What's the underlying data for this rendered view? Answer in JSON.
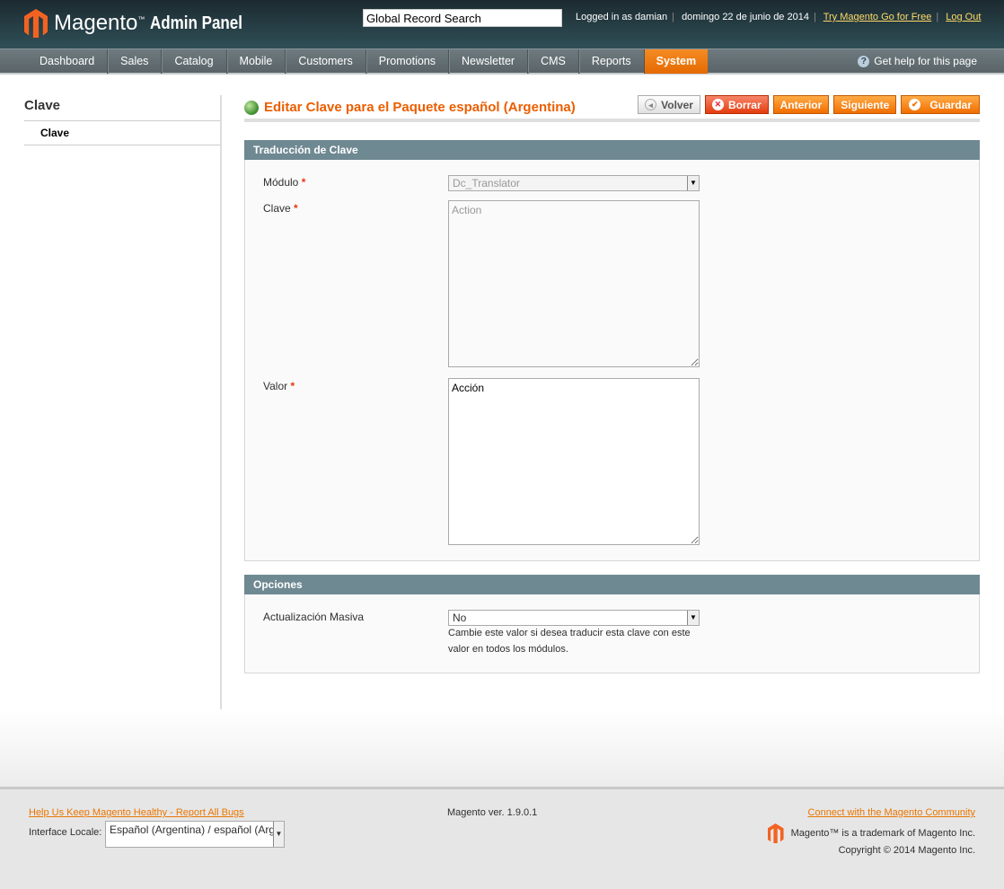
{
  "header": {
    "logo_text": "Magento",
    "logo_suffix": "Admin Panel",
    "search_placeholder": "Global Record Search",
    "logged_in": "Logged in as damian",
    "date": "domingo 22 de junio de 2014",
    "try_link": "Try Magento Go for Free",
    "logout": "Log Out"
  },
  "nav": {
    "items": [
      "Dashboard",
      "Sales",
      "Catalog",
      "Mobile",
      "Customers",
      "Promotions",
      "Newsletter",
      "CMS",
      "Reports",
      "System"
    ],
    "active": "System",
    "help": "Get help for this page"
  },
  "sidebar": {
    "title": "Clave",
    "items": [
      {
        "label": "Clave"
      }
    ]
  },
  "page": {
    "title": "Editar Clave para el Paquete español (Argentina)",
    "buttons": {
      "back": "Volver",
      "delete": "Borrar",
      "prev": "Anterior",
      "next": "Siguiente",
      "save": "Guardar"
    }
  },
  "fieldset1": {
    "title": "Traducción de Clave",
    "module_label": "Módulo",
    "module_value": "Dc_Translator",
    "key_label": "Clave",
    "key_value": "Action",
    "value_label": "Valor",
    "value_value": "Acción",
    "required": "*"
  },
  "fieldset2": {
    "title": "Opciones",
    "mass_label": "Actualización Masiva",
    "mass_value": "No",
    "note": "Cambie este valor si desea traducir esta clave con este valor en todos los módulos."
  },
  "footer": {
    "bugs_link": "Help Us Keep Magento Healthy - Report All Bugs",
    "locale_label": "Interface Locale:",
    "locale_value": "Español (Argentina) / español (Argentina)",
    "version": "Magento ver. 1.9.0.1",
    "community_link": "Connect with the Magento Community",
    "trademark": "Magento™ is a trademark of Magento Inc.",
    "copyright": "Copyright © 2014 Magento Inc."
  },
  "colors": {
    "accent": "#eb5e00",
    "fieldset_header": "#6f8992"
  }
}
